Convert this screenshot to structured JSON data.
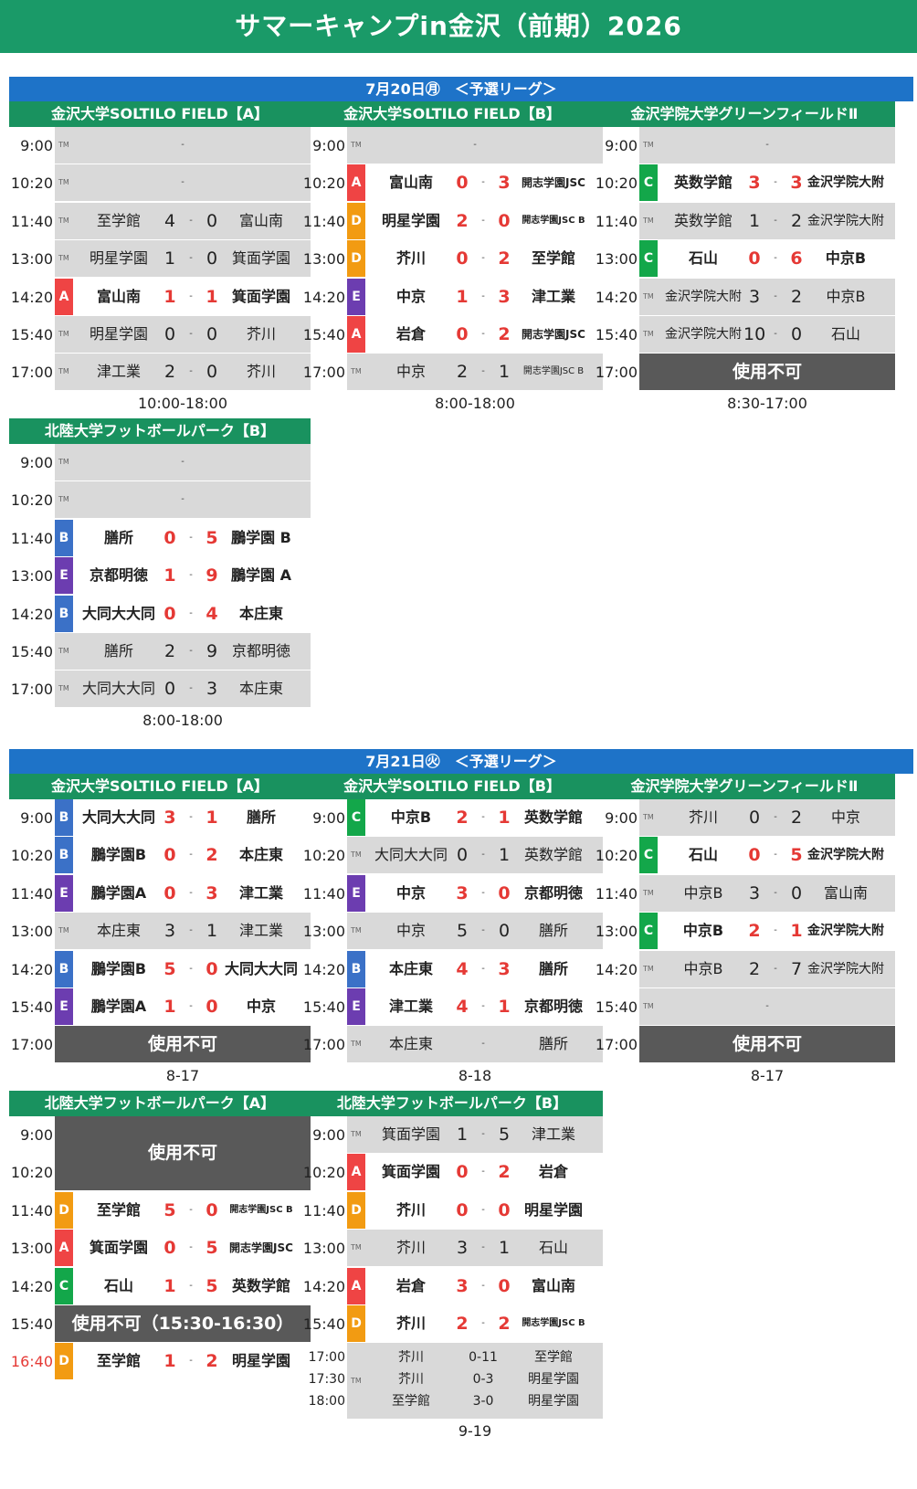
{
  "title": "サマーキャンプin金沢（前期）2026",
  "colors": {
    "A": "#ef4444",
    "B": "#3b71c7",
    "C": "#13a74a",
    "D": "#f29b12",
    "E": "#6c3db0",
    "green": "#1a9a68",
    "blue": "#1e73c8",
    "red": "#e53935"
  },
  "days": [
    {
      "header": "7月20日㊊　＜予選リーグ＞",
      "venues": [
        {
          "name": "金沢大学SOLTILO FIELD【A】",
          "hours": "10:00-18:00",
          "rows": [
            {
              "time": "9:00",
              "tm": "TM",
              "empty": "-"
            },
            {
              "time": "10:20",
              "tm": "TM",
              "empty": "-"
            },
            {
              "time": "11:40",
              "tm": "TM",
              "home": "至学館",
              "s1": "4",
              "s2": "0",
              "away": "富山南"
            },
            {
              "time": "13:00",
              "tm": "TM",
              "home": "明星学園",
              "s1": "1",
              "s2": "0",
              "away": "箕面学園"
            },
            {
              "time": "14:20",
              "badge": "A",
              "home": "富山南",
              "s1": "1",
              "s2": "1",
              "away": "箕面学園"
            },
            {
              "time": "15:40",
              "tm": "TM",
              "home": "明星学園",
              "s1": "0",
              "s2": "0",
              "away": "芥川"
            },
            {
              "time": "17:00",
              "tm": "TM",
              "home": "津工業",
              "s1": "2",
              "s2": "0",
              "away": "芥川"
            }
          ]
        },
        {
          "name": "金沢大学SOLTILO FIELD【B】",
          "hours": "8:00-18:00",
          "rows": [
            {
              "time": "9:00",
              "tm": "TM",
              "empty": "-"
            },
            {
              "time": "10:20",
              "badge": "A",
              "home": "富山南",
              "s1": "0",
              "s2": "3",
              "away": "開志学園JSC"
            },
            {
              "time": "11:40",
              "badge": "D",
              "home": "明星学園",
              "s1": "2",
              "s2": "0",
              "away": "開志学園JSC B"
            },
            {
              "time": "13:00",
              "badge": "D",
              "home": "芥川",
              "s1": "0",
              "s2": "2",
              "away": "至学館"
            },
            {
              "time": "14:20",
              "badge": "E",
              "home": "中京",
              "s1": "1",
              "s2": "3",
              "away": "津工業"
            },
            {
              "time": "15:40",
              "badge": "A",
              "home": "岩倉",
              "s1": "0",
              "s2": "2",
              "away": "開志学園JSC"
            },
            {
              "time": "17:00",
              "tm": "TM",
              "home": "中京",
              "s1": "2",
              "s2": "1",
              "away": "開志学園JSC B"
            }
          ]
        },
        {
          "name": "金沢学院大学グリーンフィールドⅡ",
          "hours": "8:30-17:00",
          "rows": [
            {
              "time": "9:00",
              "tm": "TM",
              "empty": "-"
            },
            {
              "time": "10:20",
              "badge": "C",
              "home": "英数学館",
              "s1": "3",
              "s2": "3",
              "away": "金沢学院大附"
            },
            {
              "time": "11:40",
              "tm": "TM",
              "home": "英数学館",
              "s1": "1",
              "s2": "2",
              "away": "金沢学院大附"
            },
            {
              "time": "13:00",
              "badge": "C",
              "home": "石山",
              "s1": "0",
              "s2": "6",
              "away": "中京B"
            },
            {
              "time": "14:20",
              "tm": "TM",
              "home": "金沢学院大附",
              "s1": "3",
              "s2": "2",
              "away": "中京B"
            },
            {
              "time": "15:40",
              "tm": "TM",
              "home": "金沢学院大附",
              "s1": "10",
              "s2": "0",
              "away": "石山"
            },
            {
              "time": "17:00",
              "band": "使用不可"
            }
          ]
        },
        {
          "name": "北陸大学フットボールパーク【B】",
          "hours": "8:00-18:00",
          "rows": [
            {
              "time": "9:00",
              "tm": "TM",
              "empty": "-"
            },
            {
              "time": "10:20",
              "tm": "TM",
              "empty": "-"
            },
            {
              "time": "11:40",
              "badge": "B",
              "home": "膳所",
              "s1": "0",
              "s2": "5",
              "away": "鵬学園 B"
            },
            {
              "time": "13:00",
              "badge": "E",
              "home": "京都明徳",
              "s1": "1",
              "s2": "9",
              "away": "鵬学園 A"
            },
            {
              "time": "14:20",
              "badge": "B",
              "home": "大同大大同",
              "s1": "0",
              "s2": "4",
              "away": "本庄東"
            },
            {
              "time": "15:40",
              "tm": "TM",
              "home": "膳所",
              "s1": "2",
              "s2": "9",
              "away": "京都明徳"
            },
            {
              "time": "17:00",
              "tm": "TM",
              "home": "大同大大同",
              "s1": "0",
              "s2": "3",
              "away": "本庄東"
            }
          ]
        }
      ]
    },
    {
      "header": "7月21日㊋　＜予選リーグ＞",
      "venues": [
        {
          "name": "金沢大学SOLTILO FIELD【A】",
          "hours": "8-17",
          "rows": [
            {
              "time": "9:00",
              "badge": "B",
              "home": "大同大大同",
              "s1": "3",
              "s2": "1",
              "away": "膳所"
            },
            {
              "time": "10:20",
              "badge": "B",
              "home": "鵬学園B",
              "s1": "0",
              "s2": "2",
              "away": "本庄東"
            },
            {
              "time": "11:40",
              "badge": "E",
              "home": "鵬学園A",
              "s1": "0",
              "s2": "3",
              "away": "津工業"
            },
            {
              "time": "13:00",
              "tm": "TM",
              "home": "本庄東",
              "s1": "3",
              "s2": "1",
              "away": "津工業"
            },
            {
              "time": "14:20",
              "badge": "B",
              "home": "鵬学園B",
              "s1": "5",
              "s2": "0",
              "away": "大同大大同"
            },
            {
              "time": "15:40",
              "badge": "E",
              "home": "鵬学園A",
              "s1": "1",
              "s2": "0",
              "away": "中京"
            },
            {
              "time": "17:00",
              "band": "使用不可"
            }
          ]
        },
        {
          "name": "金沢大学SOLTILO FIELD【B】",
          "hours": "8-18",
          "rows": [
            {
              "time": "9:00",
              "badge": "C",
              "home": "中京B",
              "s1": "2",
              "s2": "1",
              "away": "英数学館"
            },
            {
              "time": "10:20",
              "tm": "TM",
              "home": "大同大大同",
              "s1": "0",
              "s2": "1",
              "away": "英数学館"
            },
            {
              "time": "11:40",
              "badge": "E",
              "home": "中京",
              "s1": "3",
              "s2": "0",
              "away": "京都明徳"
            },
            {
              "time": "13:00",
              "tm": "TM",
              "home": "中京",
              "s1": "5",
              "s2": "0",
              "away": "膳所"
            },
            {
              "time": "14:20",
              "badge": "B",
              "home": "本庄東",
              "s1": "4",
              "s2": "3",
              "away": "膳所"
            },
            {
              "time": "15:40",
              "badge": "E",
              "home": "津工業",
              "s1": "4",
              "s2": "1",
              "away": "京都明徳"
            },
            {
              "time": "17:00",
              "tm": "TM",
              "home": "本庄東",
              "dash": "-",
              "away": "膳所"
            }
          ]
        },
        {
          "name": "金沢学院大学グリーンフィールドⅡ",
          "hours": "8-17",
          "rows": [
            {
              "time": "9:00",
              "tm": "TM",
              "home": "芥川",
              "s1": "0",
              "s2": "2",
              "away": "中京"
            },
            {
              "time": "10:20",
              "badge": "C",
              "home": "石山",
              "s1": "0",
              "s2": "5",
              "away": "金沢学院大附"
            },
            {
              "time": "11:40",
              "tm": "TM",
              "home": "中京B",
              "s1": "3",
              "s2": "0",
              "away": "富山南"
            },
            {
              "time": "13:00",
              "badge": "C",
              "home": "中京B",
              "s1": "2",
              "s2": "1",
              "away": "金沢学院大附"
            },
            {
              "time": "14:20",
              "tm": "TM",
              "home": "中京B",
              "s1": "2",
              "s2": "7",
              "away": "金沢学院大附"
            },
            {
              "time": "15:40",
              "tm": "TM",
              "empty": "-"
            },
            {
              "time": "17:00",
              "band": "使用不可"
            }
          ]
        },
        {
          "name": "北陸大学フットボールパーク【A】",
          "hours": "",
          "rows": [
            {
              "time": "9:00",
              "bandtall": "使用不可"
            },
            {
              "time": "10:20"
            },
            {
              "time": "11:40",
              "badge": "D",
              "home": "至学館",
              "s1": "5",
              "s2": "0",
              "away": "開志学園JSC B"
            },
            {
              "time": "13:00",
              "badge": "A",
              "home": "箕面学園",
              "s1": "0",
              "s2": "5",
              "away": "開志学園JSC"
            },
            {
              "time": "14:20",
              "badge": "C",
              "home": "石山",
              "s1": "1",
              "s2": "5",
              "away": "英数学館"
            },
            {
              "time": "15:40",
              "band": "使用不可（15:30-16:30）"
            },
            {
              "time": "16:40",
              "timeRed": true,
              "badge": "D",
              "home": "至学館",
              "s1": "1",
              "s2": "2",
              "away": "明星学園"
            }
          ]
        },
        {
          "name": "北陸大学フットボールパーク【B】",
          "hours": "9-19",
          "rows": [
            {
              "time": "9:00",
              "tm": "TM",
              "home": "箕面学園",
              "s1": "1",
              "s2": "5",
              "away": "津工業"
            },
            {
              "time": "10:20",
              "badge": "A",
              "home": "箕面学園",
              "s1": "0",
              "s2": "2",
              "away": "岩倉"
            },
            {
              "time": "11:40",
              "badge": "D",
              "home": "芥川",
              "s1": "0",
              "s2": "0",
              "away": "明星学園"
            },
            {
              "time": "13:00",
              "tm": "TM",
              "home": "芥川",
              "s1": "3",
              "s2": "1",
              "away": "石山"
            },
            {
              "time": "14:20",
              "badge": "A",
              "home": "岩倉",
              "s1": "3",
              "s2": "0",
              "away": "富山南"
            },
            {
              "time": "15:40",
              "badge": "D",
              "home": "芥川",
              "s1": "2",
              "s2": "2",
              "away": "開志学園JSC B"
            }
          ],
          "mini": {
            "tm": "TM",
            "lines": [
              {
                "time": "17:00",
                "home": "芥川",
                "score": "0-11",
                "away": "至学館"
              },
              {
                "time": "17:30",
                "home": "芥川",
                "score": "0-3",
                "away": "明星学園"
              },
              {
                "time": "18:00",
                "home": "至学館",
                "score": "3-0",
                "away": "明星学園"
              }
            ]
          }
        }
      ]
    }
  ]
}
